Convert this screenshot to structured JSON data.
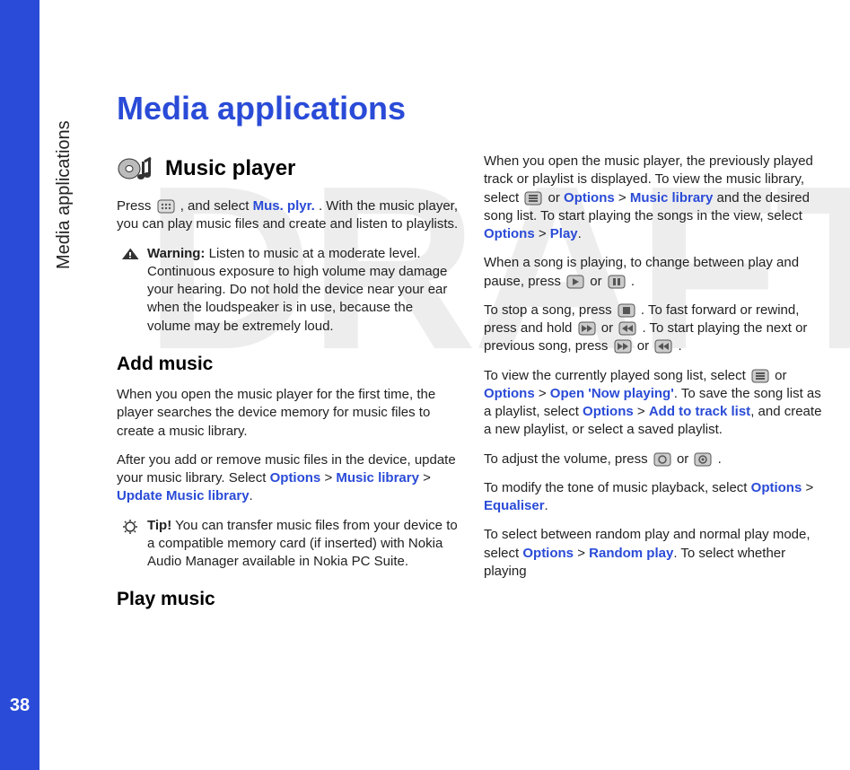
{
  "pageNumber": "38",
  "sideLabel": "Media applications",
  "watermark": "DRAFT",
  "title": "Media applications",
  "musicPlayer": {
    "heading": "Music player",
    "intro_a": "Press ",
    "intro_b": " , and select ",
    "intro_link": "Mus. plyr.",
    "intro_c": ". With the music player, you can play music files and create and listen to playlists.",
    "warning_label": "Warning:",
    "warning_body": " Listen to music at a moderate level. Continuous exposure to high volume may damage your hearing. Do not hold the device near your ear when the loudspeaker is in use, because the volume may be extremely loud."
  },
  "addMusic": {
    "heading": "Add music",
    "p1": "When you open the music player for the first time, the player searches the device memory for music files to create a music library.",
    "p2_a": "After you add or remove music files in the device, update your music library. Select ",
    "p2_opt": "Options",
    "p2_gt1": " > ",
    "p2_ml": "Music library",
    "p2_gt2": " > ",
    "p2_uml": "Update Music library",
    "p2_end": ".",
    "tip_label": "Tip!",
    "tip_body": " You can transfer music files from your device to a compatible memory card (if inserted) with Nokia Audio Manager available in Nokia PC Suite."
  },
  "playMusic": {
    "heading": "Play music",
    "p1_a": "When you open the music player, the previously played track or playlist is displayed. To view the music library, select ",
    "p1_b": " or ",
    "p1_opt": "Options",
    "p1_gt": " > ",
    "p1_ml": "Music library",
    "p1_c": " and the desired song list. To start playing the songs in the view, select ",
    "p1_opt2": "Options",
    "p1_gt2": " > ",
    "p1_play": "Play",
    "p1_end": ".",
    "p2_a": "When a song is playing, to change between play and pause, press ",
    "p2_b": " or ",
    "p2_c": " .",
    "p3_a": "To stop a song, press ",
    "p3_b": " . To fast forward or rewind, press and hold ",
    "p3_c": " or ",
    "p3_d": " . To start playing the next or previous song, press ",
    "p3_e": " or ",
    "p3_f": " .",
    "p4_a": "To view the currently played song list, select ",
    "p4_b": " or ",
    "p4_opt": "Options",
    "p4_gt": " > ",
    "p4_np": "Open 'Now playing'",
    "p4_c": ". To save the song list as a playlist, select ",
    "p4_opt2": "Options",
    "p4_gt2": " > ",
    "p4_atl": "Add to track list",
    "p4_d": ", and create a new playlist, or select a saved playlist.",
    "p5_a": "To adjust the volume, press ",
    "p5_b": " or ",
    "p5_c": ".",
    "p6_a": "To modify the tone of music playback, select ",
    "p6_opt": "Options",
    "p6_gt": " > ",
    "p6_eq": "Equaliser",
    "p6_b": ".",
    "p7_a": "To select between random play and normal play mode, select ",
    "p7_opt": "Options",
    "p7_gt": " > ",
    "p7_rp": "Random play",
    "p7_b": ". To select whether playing"
  }
}
